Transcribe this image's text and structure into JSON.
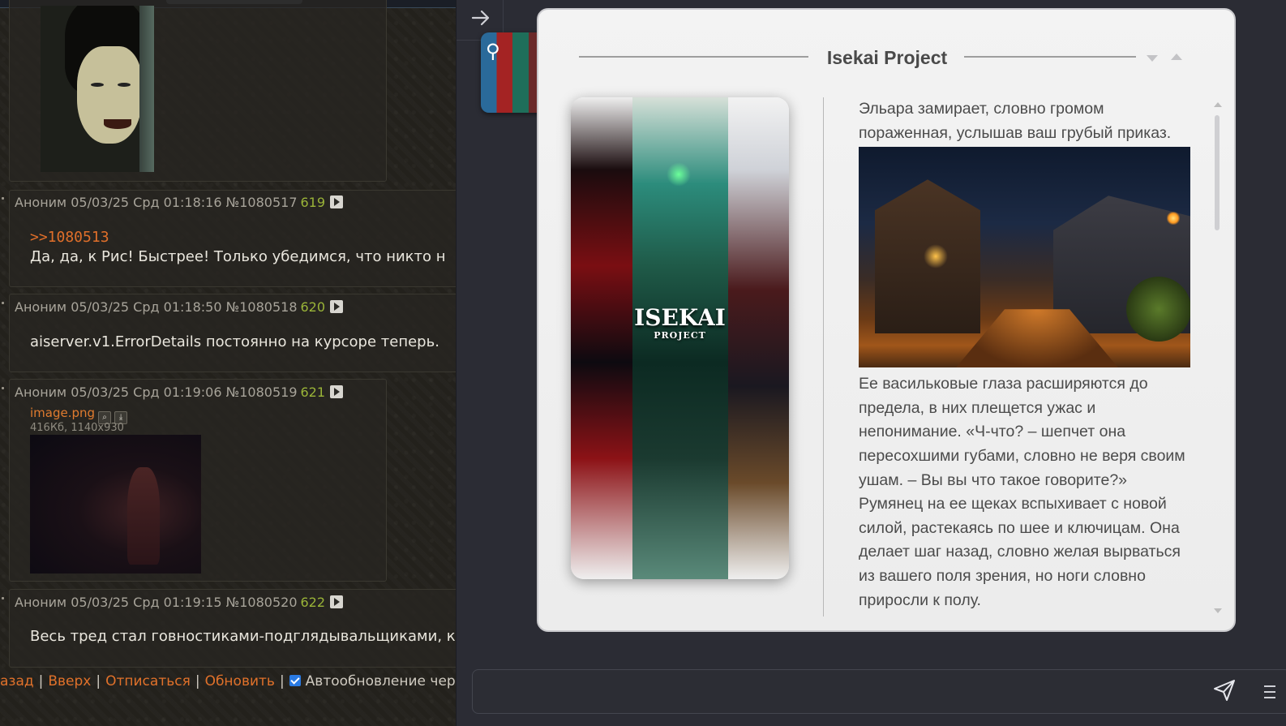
{
  "forum": {
    "posts": [
      {
        "author": "Аноним",
        "date": "05/03/25 Срд 01:18:16",
        "id": "№1080517",
        "num": "619",
        "reply": ">>1080513",
        "text": "Да, да, к Рис! Быстрее! Только убедимся, что никто н"
      },
      {
        "author": "Аноним",
        "date": "05/03/25 Срд 01:18:50",
        "id": "№1080518",
        "num": "620",
        "text": "aiserver.v1.ErrorDetails постоянно на курсоре теперь."
      },
      {
        "author": "Аноним",
        "date": "05/03/25 Срд 01:19:06",
        "id": "№1080519",
        "num": "621",
        "file": {
          "name": "image.png",
          "meta": "416Кб, 1140x930"
        }
      },
      {
        "author": "Аноним",
        "date": "05/03/25 Срд 01:19:15",
        "id": "№1080520",
        "num": "622",
        "text": "Весь тред стал говностиками-подглядывальщиками, к"
      }
    ],
    "bottom_nav": {
      "back": "азад",
      "up": "Вверх",
      "unsubscribe": "Отписаться",
      "refresh": "Обновить",
      "autoupdate": "Автообновление чере:"
    }
  },
  "chat": {
    "card_title": "Isekai Project",
    "poster_logo": "ISEKAI",
    "poster_logo_sub": "PROJECT",
    "avatar_symbol": "⚲",
    "story": {
      "p1": "Эльара замирает, словно громом пораженная, услышав ваш грубый приказ.",
      "p2": "Ее васильковые глаза расширяются до предела, в них плещется ужас и непонимание. «Ч-что? – шепчет она пересохшими губами, словно не веря своим ушам. – Вы вы что такое говорите?» Румянец на ее щеках вспыхивает с новой силой, растекаясь по шее и ключицам. Она делает шаг назад, словно желая вырваться из вашего поля зрения, но ноги словно приросли к полу."
    }
  }
}
